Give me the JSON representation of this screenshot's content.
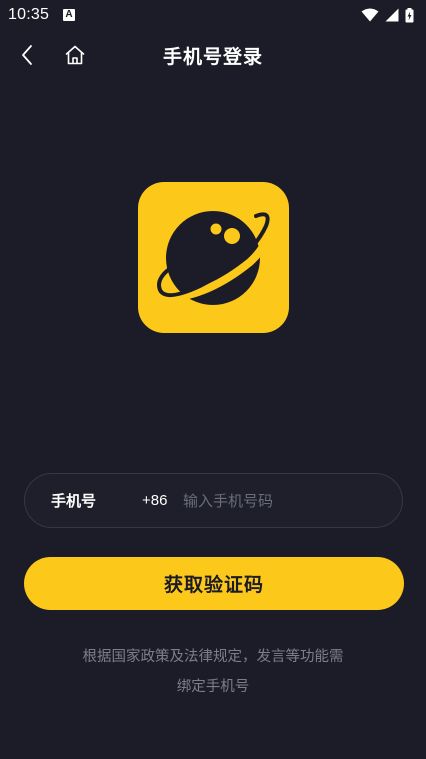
{
  "status_bar": {
    "time": "10:35",
    "badge_letter": "A",
    "icons": [
      "wifi-icon",
      "signal-icon",
      "battery-charging-icon"
    ]
  },
  "nav": {
    "title": "手机号登录",
    "back_icon": "chevron-left-icon",
    "home_icon": "home-icon"
  },
  "logo": {
    "icon": "planet-icon",
    "background_color": "#fcc81a"
  },
  "phone_field": {
    "label": "手机号",
    "country_code": "+86",
    "placeholder": "输入手机号码",
    "value": ""
  },
  "get_code_button": {
    "label": "获取验证码",
    "color": "#fcc81a"
  },
  "policy": {
    "line1": "根据国家政策及法律规定，发言等功能需",
    "line2": "绑定手机号"
  },
  "colors": {
    "background": "#1b1c27",
    "accent": "#fcc81a",
    "muted_text": "#7c7e8c"
  }
}
